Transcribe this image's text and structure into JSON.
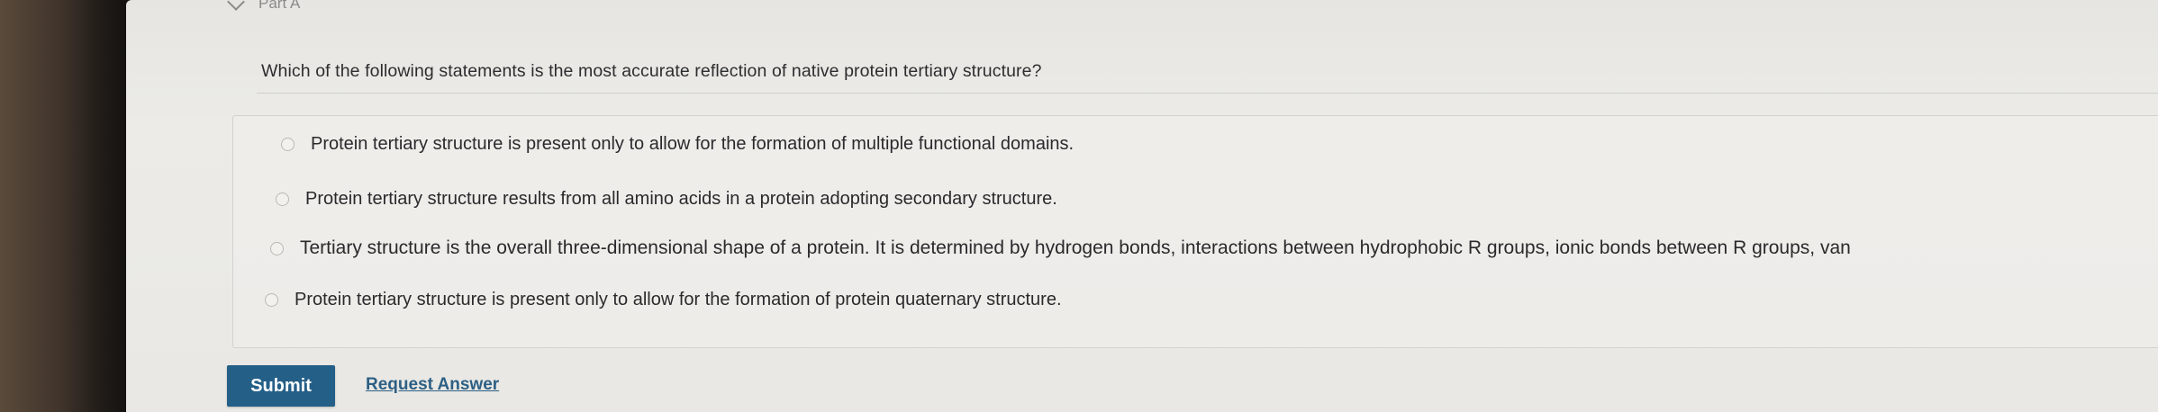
{
  "part": {
    "title": "Part A",
    "icon": "chevron-down-icon"
  },
  "question": {
    "text": "Which of the following statements is the most accurate reflection of native protein tertiary structure?"
  },
  "options": [
    {
      "text": "Protein tertiary structure is present only to allow for the formation of multiple functional domains."
    },
    {
      "text": "Protein tertiary structure results from all amino acids in a protein adopting secondary structure."
    },
    {
      "text": "Tertiary structure is the overall three-dimensional shape of a protein. It is determined by hydrogen bonds, interactions between hydrophobic R groups, ionic bonds between R groups, van"
    },
    {
      "text": "Protein tertiary structure is present only to allow for the formation of protein quaternary structure."
    }
  ],
  "actions": {
    "submit_label": "Submit",
    "request_answer_label": "Request Answer"
  },
  "colors": {
    "submit_bg": "#245f88",
    "link": "#2d5f84"
  }
}
